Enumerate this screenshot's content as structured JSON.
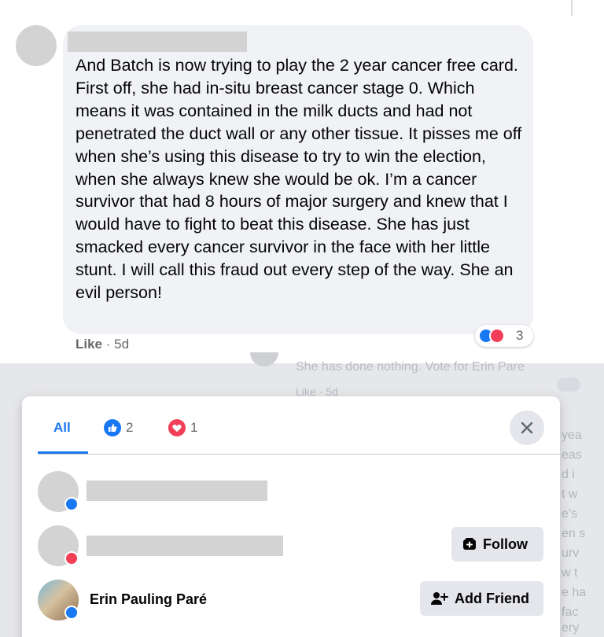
{
  "comment": {
    "text": "And Batch is now trying to play the 2 year cancer free card. First off, she had in-situ breast cancer stage 0. Which means it was contained in the milk ducts and had not penetrated the duct wall or any other tissue. It pisses me off when she’s using this disease to try to win the election, when she always knew she would be ok. I’m a cancer survivor that had 8 hours of major surgery and knew that I would have to fight to beat this disease. She has just smacked every cancer survivor in the face with her little stunt. I will call this fraud out every step of the way. She an evil person!",
    "like_label": "Like",
    "separator": " · ",
    "time": "5d",
    "reaction_count": "3"
  },
  "background": {
    "reply_text": "She has done nothing. Vote for Erin Pare",
    "reply_meta": "Like · 5d",
    "fragments": [
      "yea",
      "eas",
      "d i",
      "t w",
      "e’s",
      "en s",
      "urv",
      "w t",
      "e ha",
      "fac",
      "ery"
    ]
  },
  "reactions_modal": {
    "tabs": [
      {
        "label": "All"
      },
      {
        "label": "2",
        "icon": "like-icon"
      },
      {
        "label": "1",
        "icon": "love-icon"
      }
    ],
    "users": [
      {
        "name": "",
        "reaction": "like"
      },
      {
        "name": "",
        "reaction": "love",
        "action": "Follow"
      },
      {
        "name": "Erin Pauling Paré",
        "reaction": "like",
        "action": "Add Friend"
      }
    ]
  },
  "colors": {
    "accent": "#1877f2",
    "love": "#f33e58",
    "bubble": "#f0f2f5",
    "button": "#e4e6eb"
  }
}
